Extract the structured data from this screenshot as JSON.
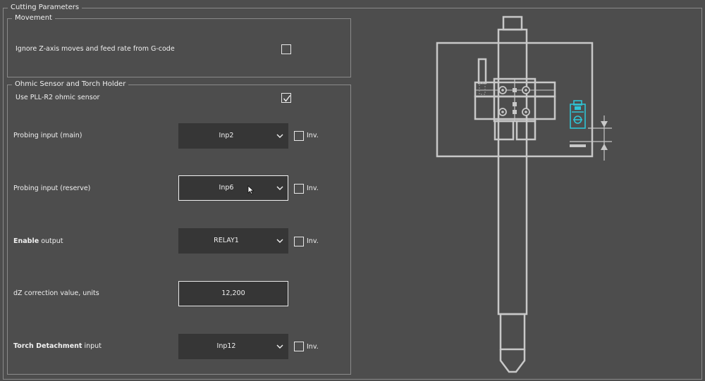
{
  "cutting_parameters": {
    "title": "Cutting Parameters"
  },
  "movement": {
    "title": "Movement",
    "ignore_z": {
      "label": "Ignore Z-axis moves and feed rate from G-code",
      "checked": false
    }
  },
  "ohmic": {
    "title": "Ohmic Sensor and Torch Holder",
    "use_pll": {
      "label": "Use PLL-R2 ohmic sensor",
      "checked": true
    },
    "probing_main": {
      "label": "Probing input (main)",
      "value": "Inp2",
      "inv_label": "Inv.",
      "inv_checked": false
    },
    "probing_reserve": {
      "label": "Probing input (reserve)",
      "value": "Inp6",
      "inv_label": "Inv.",
      "inv_checked": false
    },
    "enable_output": {
      "label_bold": "Enable",
      "label_rest": " output",
      "value": "RELAY1",
      "inv_label": "Inv.",
      "inv_checked": false
    },
    "dz_correction": {
      "label": "dZ correction value, units",
      "value": "12,200"
    },
    "torch_detachment": {
      "label_bold": "Torch Detachment",
      "label_rest": " input",
      "value": "Inp12",
      "inv_label": "Inv.",
      "inv_checked": false
    }
  },
  "colors": {
    "background": "#4d4d4d",
    "control_bg": "#363636",
    "diagram_stroke": "#c8c8c8",
    "sensor_accent": "#2ec4d6"
  }
}
